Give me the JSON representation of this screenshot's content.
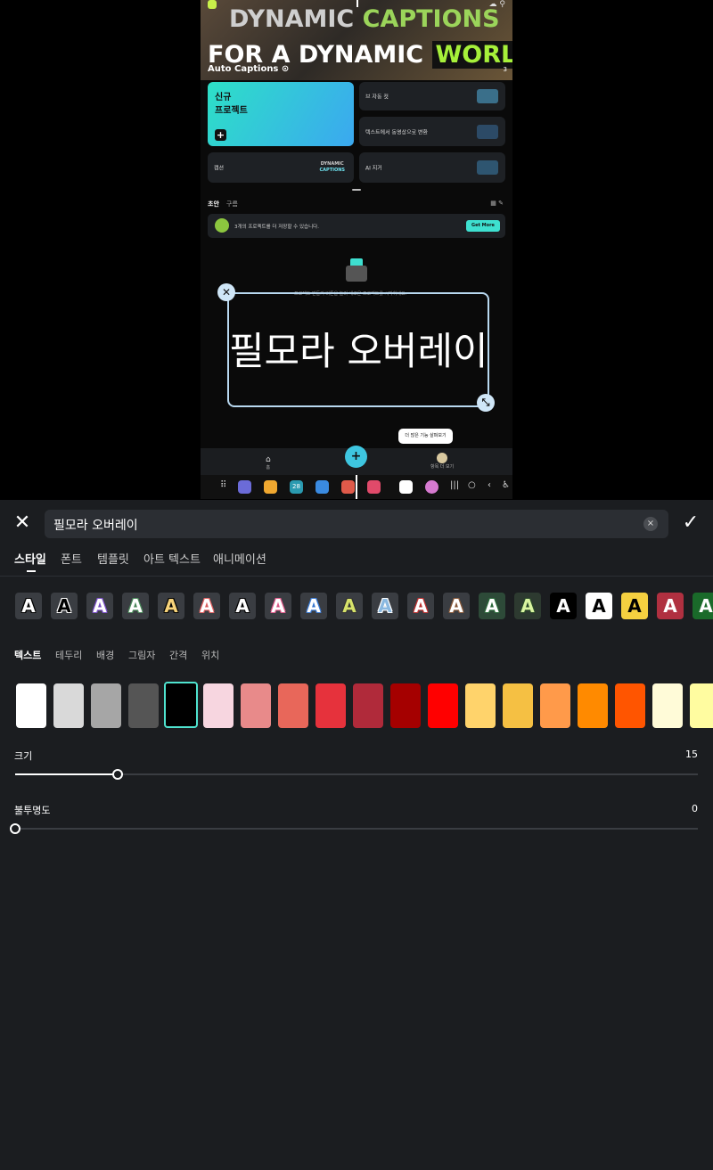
{
  "preview": {
    "hero": {
      "line1_a": "DYNAMIC ",
      "line1_b": "CAPTIONS",
      "line2_a": "FOR A DYNAMIC ",
      "line2_b": "WORLD",
      "sub": "Auto Captions ⊙",
      "page": "3"
    },
    "cards": {
      "new_line1": "신규",
      "new_line2": "프로젝트",
      "new_plus": "+",
      "c1": "브 자동 컷",
      "c2": "텍스트에서 동영상으로 변환",
      "c3": "캡션",
      "c3_badge_a": "DYNAMIC",
      "c3_badge_b": "CAPTIONS",
      "c4": "AI 지거"
    },
    "mini_tabs": [
      "초안",
      "구름"
    ],
    "banner": {
      "text": "3개의 프로젝트를 더 저장할 수 있습니다.",
      "button": "Get More"
    },
    "hint": "프로젝트 만들기 버튼을 눌러 새로운 프로젝트를 시작하세요.",
    "overlay_text": "필모라 오버레이",
    "tooltip": "더 많은 기능 살펴보기",
    "nav": {
      "home_label": "홈",
      "plus": "+",
      "me_label": "항목 더 보기"
    },
    "taskbar": {
      "calendar_day": "28"
    }
  },
  "editor": {
    "text_value": "필모라 오버레이",
    "clear_symbol": "×",
    "main_tabs": [
      "스타일",
      "폰트",
      "템플릿",
      "아트 텍스트",
      "애니메이션"
    ],
    "preset_glyph": "A",
    "sub_tabs": [
      "텍스트",
      "테두리",
      "배경",
      "그림자",
      "간격",
      "위치"
    ],
    "size_label": "크기",
    "size_value": "15",
    "opacity_label": "불투명도",
    "opacity_value": "0",
    "size_fraction": 0.15,
    "opacity_fraction": 0.0
  },
  "colors": {
    "accent": "#4fe3cf",
    "swatches": [
      "#ffffff",
      "#d9d9d9",
      "#a6a6a6",
      "#555555",
      "#000000",
      "#f7d6e0",
      "#e88a8a",
      "#e8675a",
      "#e6323c",
      "#b02a3a",
      "#a50000",
      "#ff0000",
      "#ffd36b",
      "#f5c043",
      "#ff9a4a",
      "#ff8a00",
      "#ff5500",
      "#fffbd8",
      "#fffca0"
    ],
    "presets": [
      {
        "fill": "#ffffff",
        "stroke": "#000000",
        "bg": "#3a3d42"
      },
      {
        "fill": "#000000",
        "stroke": "#ffffff",
        "bg": "#3a3d42"
      },
      {
        "fill": "#ffffff",
        "stroke": "#7b4fc9",
        "bg": "#3a3d42"
      },
      {
        "fill": "#ffffff",
        "stroke": "#4a8a5a",
        "bg": "#3a3d42"
      },
      {
        "fill": "#f7d37a",
        "stroke": "#000000",
        "bg": "#3a3d42"
      },
      {
        "fill": "#ffffff",
        "stroke": "#e06060",
        "bg": "#3a3d42"
      },
      {
        "fill": "#ffffff",
        "stroke": "#000000",
        "bg": "#3a3d42"
      },
      {
        "fill": "#ffffff",
        "stroke": "#e05a8a",
        "bg": "#3a3d42"
      },
      {
        "fill": "#ffffff",
        "stroke": "#3a7bd5",
        "bg": "#3a3d42"
      },
      {
        "fill": "#d7e36a",
        "stroke": "#333333",
        "bg": "#3a3d42"
      },
      {
        "fill": "#8ab8e0",
        "stroke": "#ffffff",
        "bg": "#3a3d42"
      },
      {
        "fill": "#ffffff",
        "stroke": "#c03030",
        "bg": "#3a3d42"
      },
      {
        "fill": "#ffffff",
        "stroke": "#8a5a3a",
        "bg": "#3a3d42"
      },
      {
        "fill": "#ffffff",
        "stroke": "#2a6a3a",
        "bg": "#2d4a38"
      },
      {
        "fill": "#d9f5a0",
        "stroke": "#2a4a2a",
        "bg": "#2d3a30"
      },
      {
        "fill": "#ffffff",
        "stroke": "#000000",
        "bg": "#000000"
      },
      {
        "fill": "#000000",
        "stroke": "#ffffff",
        "bg": "#ffffff"
      },
      {
        "fill": "#000000",
        "stroke": "#f5d040",
        "bg": "#f5d040"
      },
      {
        "fill": "#ffffff",
        "stroke": "#b03040",
        "bg": "#b03040"
      },
      {
        "fill": "#ffffff",
        "stroke": "#1a6a2a",
        "bg": "#1a6a2a"
      }
    ]
  }
}
